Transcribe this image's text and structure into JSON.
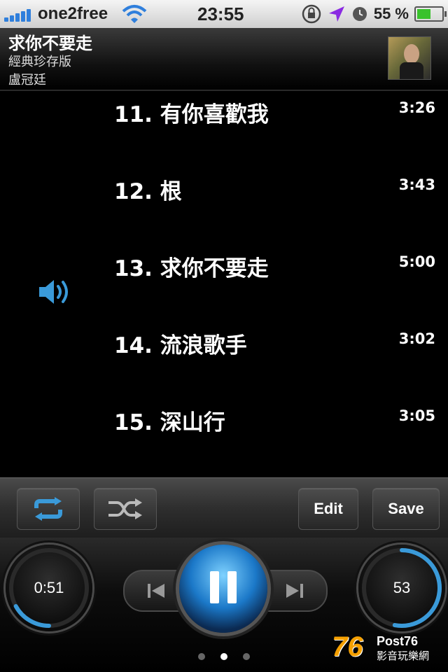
{
  "status_bar": {
    "carrier": "one2free",
    "time": "23:55",
    "battery_percent": "55 %",
    "battery_level": 0.55,
    "icons": [
      "signal-icon",
      "wifi-icon",
      "rotation-lock-icon",
      "location-arrow-icon",
      "alarm-clock-icon",
      "battery-icon"
    ]
  },
  "now_playing": {
    "title": "求你不要走",
    "album": "經典珍存版",
    "artist": "盧冠廷"
  },
  "tracks": [
    {
      "name": "11. 有你喜歡我",
      "duration": "3:26",
      "playing": false
    },
    {
      "name": "12. 根",
      "duration": "3:43",
      "playing": false
    },
    {
      "name": "13. 求你不要走",
      "duration": "5:00",
      "playing": true
    },
    {
      "name": "14. 流浪歌手",
      "duration": "3:02",
      "playing": false
    },
    {
      "name": "15. 深山行",
      "duration": "3:05",
      "playing": false
    }
  ],
  "toolbar": {
    "repeat_icon": "repeat-icon",
    "shuffle_icon": "shuffle-icon",
    "edit_label": "Edit",
    "save_label": "Save"
  },
  "player": {
    "elapsed": "0:51",
    "elapsed_fraction": 0.17,
    "volume": "53",
    "volume_fraction": 0.53,
    "page_count": 3,
    "current_page": 2
  },
  "watermark": {
    "number": "76",
    "post": "Post76",
    "subtitle": "影音玩樂網"
  },
  "colors": {
    "accent": "#3a9ad9",
    "battery": "#39c22c",
    "watermark": "#f5a000"
  }
}
